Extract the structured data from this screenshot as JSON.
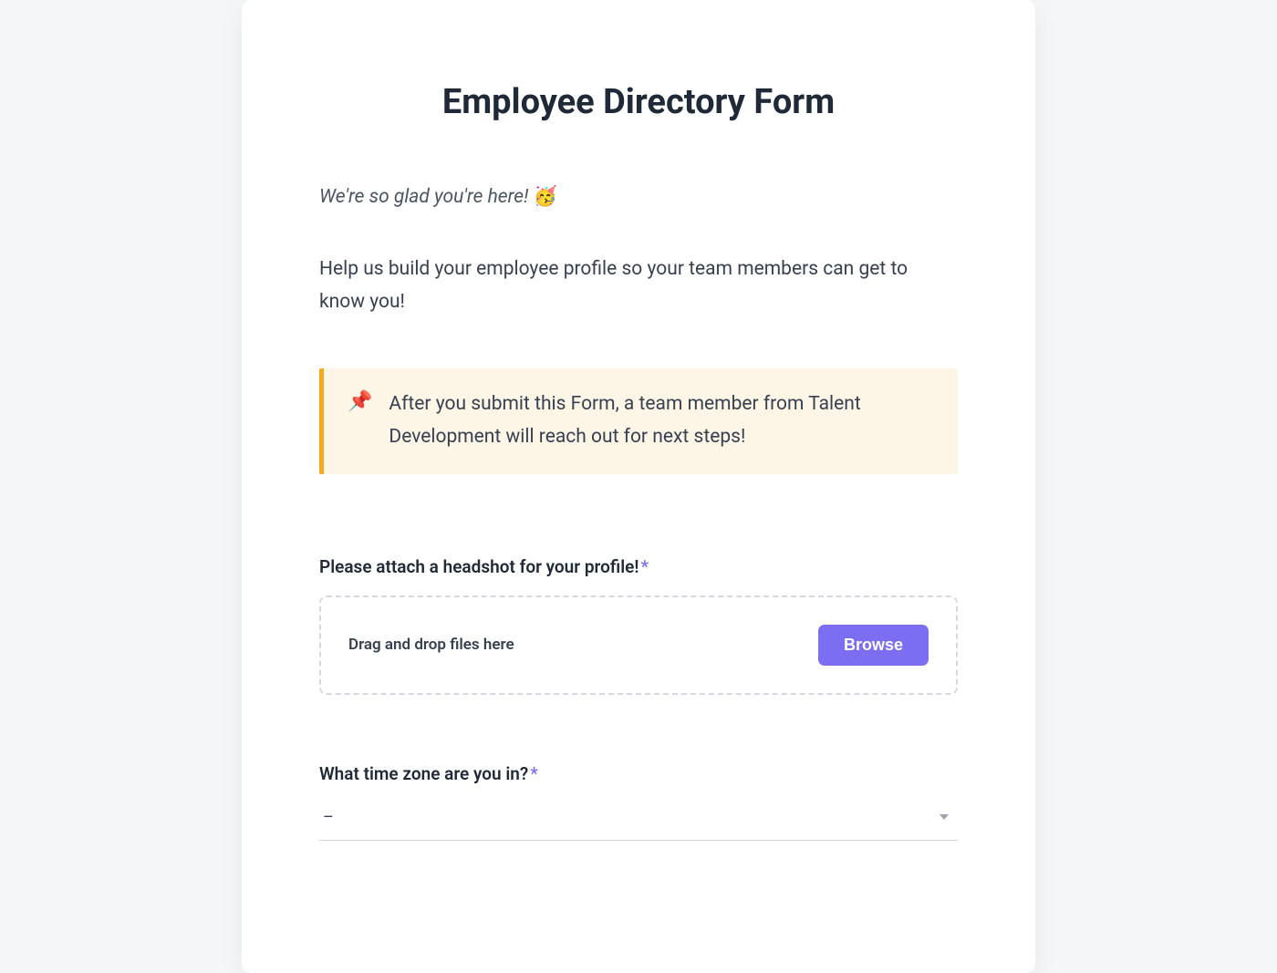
{
  "form": {
    "title": "Employee Directory Form",
    "welcome_text": "We're so glad you're here! ",
    "welcome_emoji": "🥳",
    "description": "Help us build your employee profile so your team members can get to know you!",
    "callout": {
      "icon": "📌",
      "message": "After you submit this Form, a team member from Talent Development will reach out for next steps!"
    },
    "fields": {
      "headshot": {
        "label": "Please attach a headshot for your profile!",
        "required_marker": "*",
        "dropzone_text": "Drag and drop files here",
        "browse_label": "Browse"
      },
      "timezone": {
        "label": "What time zone are you in?",
        "required_marker": "*",
        "selected": "–"
      }
    }
  },
  "colors": {
    "accent": "#7c6ef2",
    "callout_bg": "#fdf6e7",
    "callout_border": "#f6a91b"
  }
}
